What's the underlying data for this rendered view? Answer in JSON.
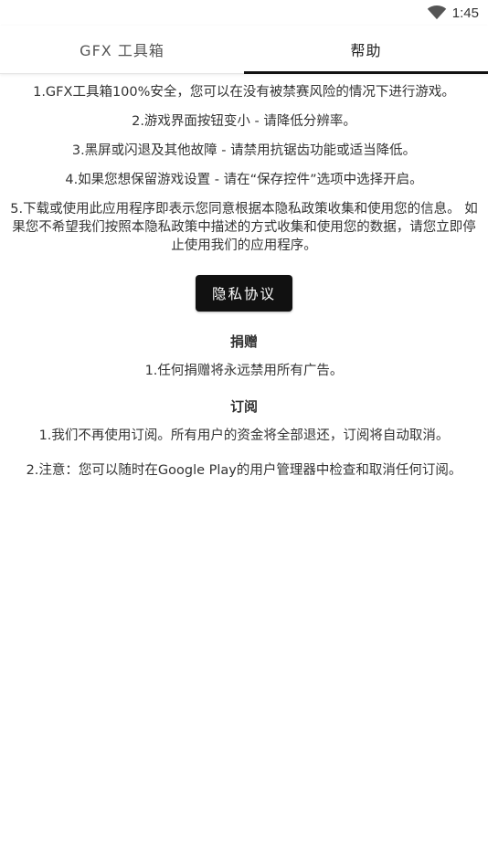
{
  "status_bar": {
    "time": "1:45",
    "wifi_icon": "wifi-icon"
  },
  "tabs": [
    {
      "label": "GFX 工具箱",
      "active": false
    },
    {
      "label": "帮助",
      "active": true
    }
  ],
  "help": {
    "lines": [
      "1.GFX工具箱100%安全，您可以在没有被禁赛风险的情况下进行游戏。",
      "2.游戏界面按钮变小 - 请降低分辨率。",
      "3.黑屏或闪退及其他故障 - 请禁用抗锯齿功能或适当降低。",
      "4.如果您想保留游戏设置 - 请在“保存控件”选项中选择开启。",
      "5.下载或使用此应用程序即表示您同意根据本隐私政策收集和使用您的信息。 如果您不希望我们按照本隐私政策中描述的方式收集和使用您的数据，请您立即停止使用我们的应用程序。"
    ],
    "privacy_button_label": "隐私协议"
  },
  "donation": {
    "title": "捐赠",
    "lines": [
      "1.任何捐赠将永远禁用所有广告。"
    ]
  },
  "subscription": {
    "title": "订阅",
    "lines": [
      "1.我们不再使用订阅。所有用户的资金将全部退还，订阅将自动取消。",
      "2.注意：您可以随时在Google Play的用户管理器中检查和取消任何订阅。"
    ]
  },
  "colors": {
    "accent": "#111111",
    "text": "#333333",
    "background": "#ffffff"
  }
}
